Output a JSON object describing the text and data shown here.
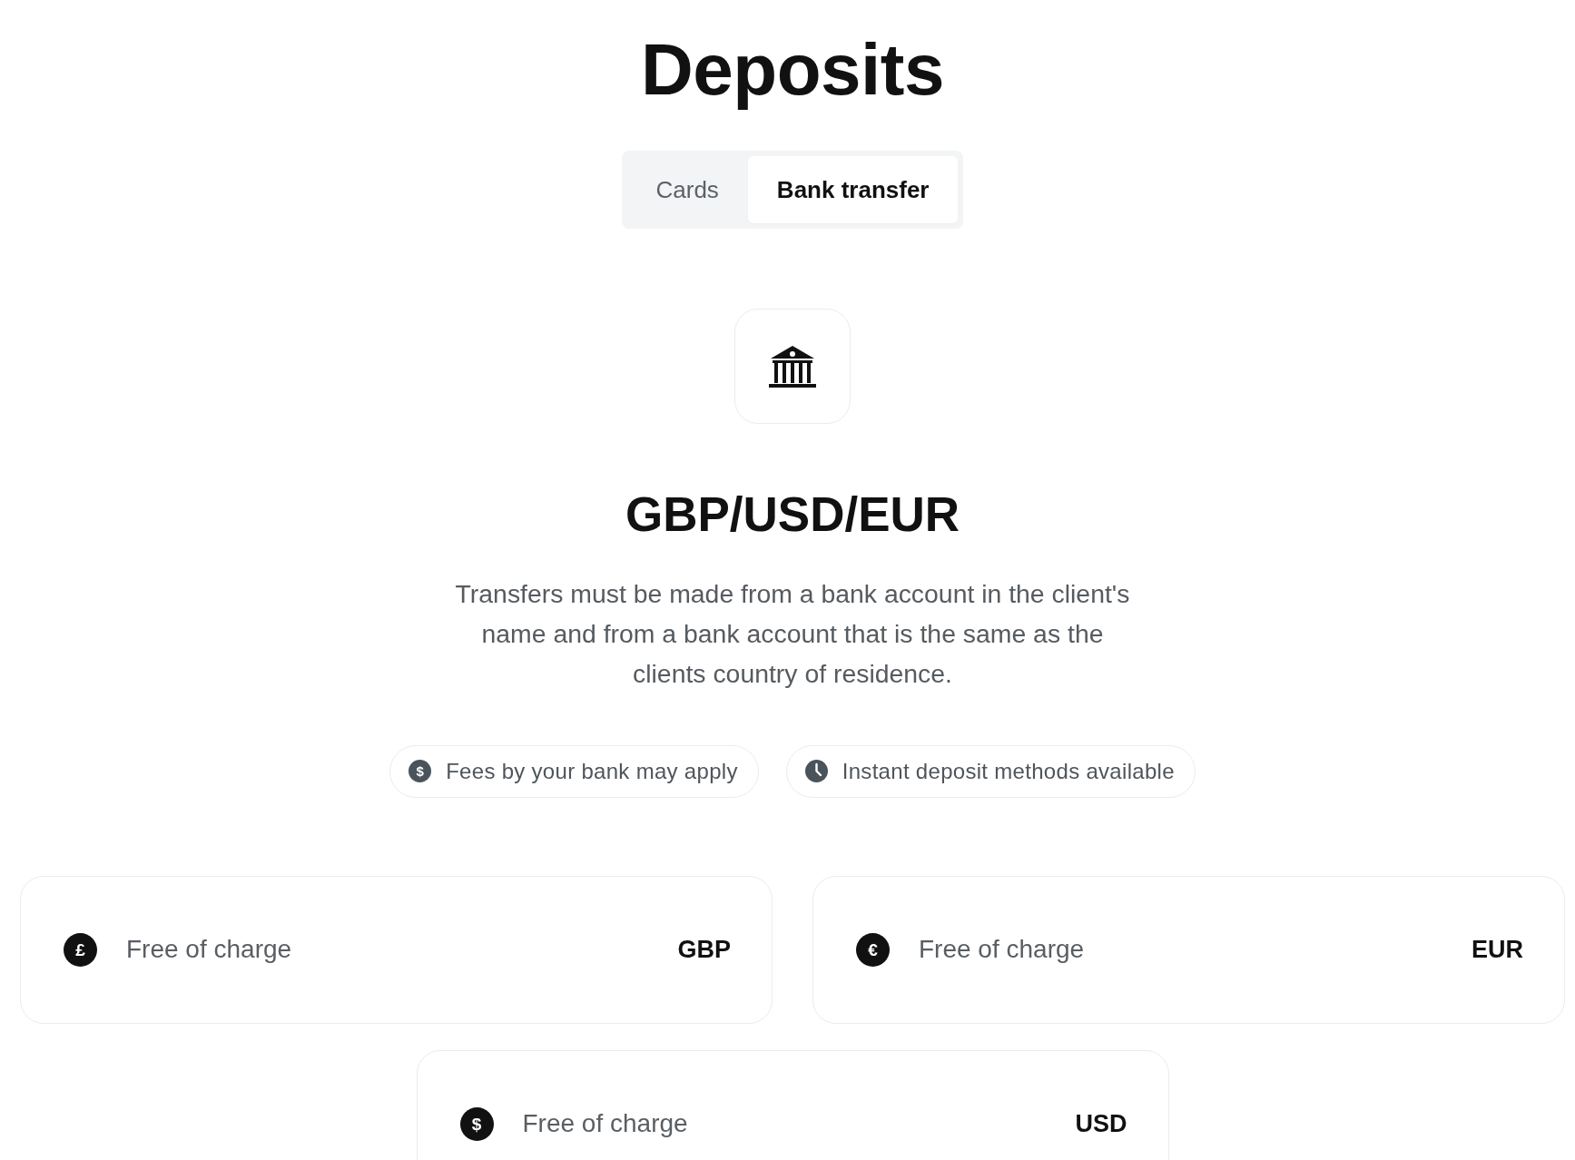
{
  "title": "Deposits",
  "tabs": [
    {
      "label": "Cards",
      "selected": false
    },
    {
      "label": "Bank transfer",
      "selected": true
    }
  ],
  "method": {
    "title": "GBP/USD/EUR",
    "description": "Transfers must be made from a bank account in the client's name and from a bank account that is the same as the clients country of residence."
  },
  "notes": [
    {
      "kind": "coin",
      "symbol": "$",
      "text": "Fees by your bank may apply"
    },
    {
      "kind": "clock",
      "text": "Instant deposit methods available"
    }
  ],
  "currencies": [
    {
      "symbol": "£",
      "fee": "Free of charge",
      "code": "GBP"
    },
    {
      "symbol": "€",
      "fee": "Free of charge",
      "code": "EUR"
    },
    {
      "symbol": "$",
      "fee": "Free of charge",
      "code": "USD"
    }
  ]
}
